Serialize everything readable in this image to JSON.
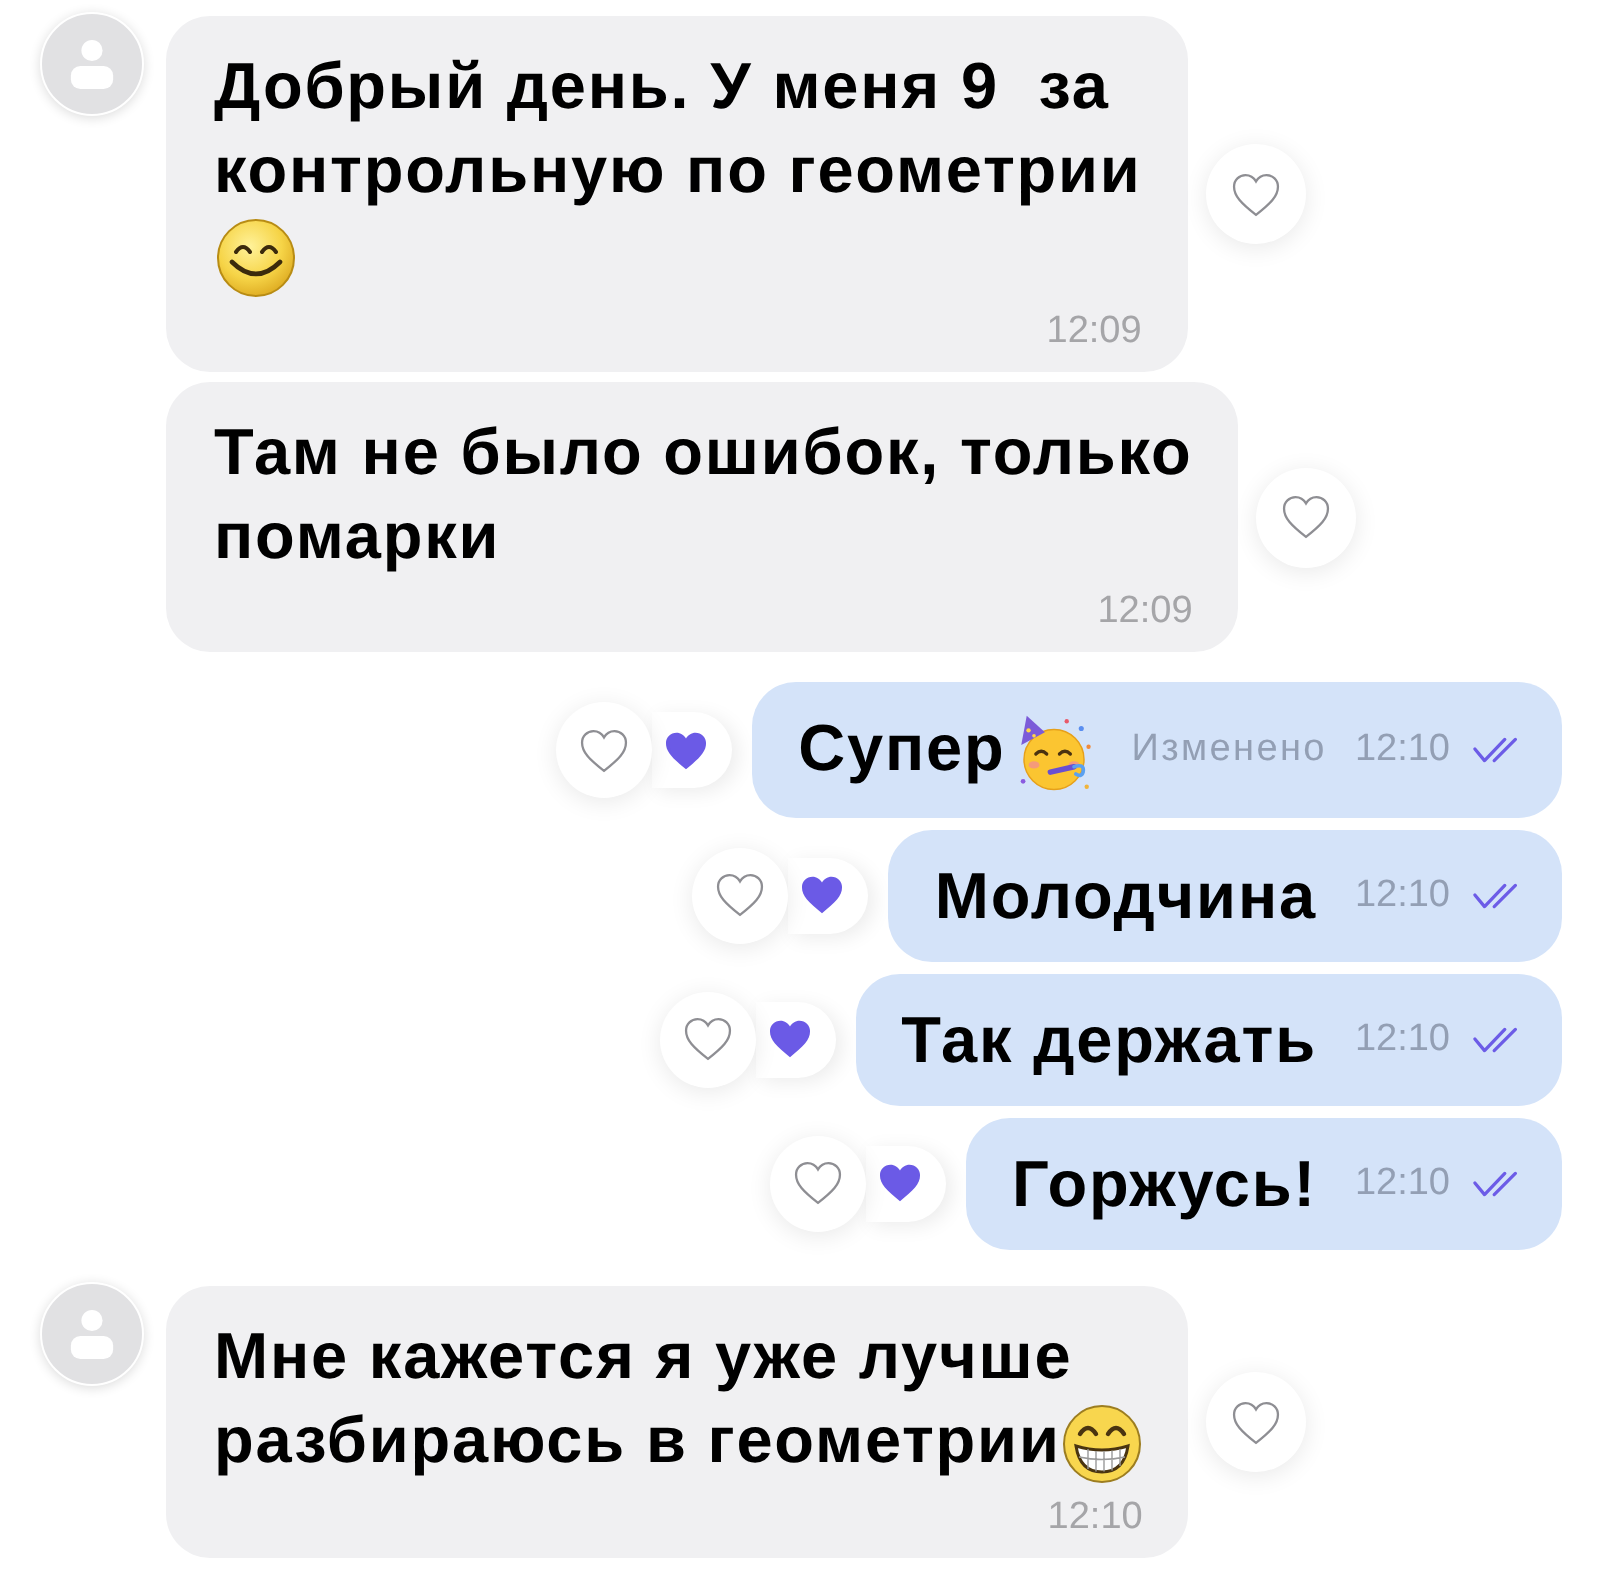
{
  "messages": [
    {
      "kind": "incoming",
      "avatar": true,
      "lines": [
        "Добрый день. У меня 9  за",
        "контрольную по геометрии"
      ],
      "emoji": {
        "kind": "smiling",
        "new_line": true
      },
      "time": "12:09"
    },
    {
      "kind": "incoming",
      "avatar": false,
      "lines": [
        "Там не было ошибок, только",
        "помарки"
      ],
      "time": "12:09"
    },
    {
      "kind": "outgoing",
      "lines": [
        "Супер"
      ],
      "emoji": {
        "kind": "partying",
        "new_line": false
      },
      "edited": "Изменено",
      "time": "12:10",
      "read": true,
      "liked": true
    },
    {
      "kind": "outgoing",
      "lines": [
        "Молодчина"
      ],
      "time": "12:10",
      "read": true,
      "liked": true
    },
    {
      "kind": "outgoing",
      "lines": [
        "Так держать"
      ],
      "time": "12:10",
      "read": true,
      "liked": true
    },
    {
      "kind": "outgoing",
      "lines": [
        "Горжусь!"
      ],
      "time": "12:10",
      "read": true,
      "liked": true
    },
    {
      "kind": "incoming",
      "avatar": true,
      "lines": [
        "Мне кажется я уже лучше",
        "разбираюсь в геометрии"
      ],
      "emoji": {
        "kind": "grinning",
        "new_line": false
      },
      "time": "12:10"
    }
  ]
}
